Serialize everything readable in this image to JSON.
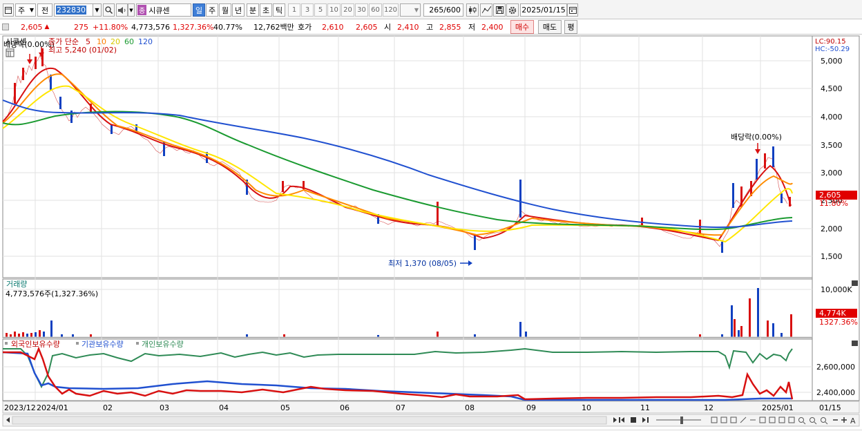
{
  "toolbar": {
    "market": "주",
    "prev": "전",
    "code": "232830",
    "stock_badge": "종",
    "stock_name": "시큐센",
    "periods": [
      "일",
      "주",
      "월",
      "년",
      "분",
      "초",
      "틱"
    ],
    "active_period": "일",
    "intervals": [
      "1",
      "3",
      "5",
      "10",
      "20",
      "30",
      "60",
      "120"
    ],
    "count": "265",
    "count_total": "/600",
    "date": "2025/01/15"
  },
  "quote": {
    "price": "2,605",
    "change": "275",
    "change_pct": "+11.80%",
    "volume": "4,773,576",
    "volume_pct": "1,327.36%",
    "turnover_pct": "40.77%",
    "amount": "12,762백만",
    "hoga_label": "호가",
    "ask": "2,610",
    "bid": "2,605",
    "open_label": "시",
    "open": "2,410",
    "high_label": "고",
    "high": "2,855",
    "low_label": "저",
    "low": "2,400",
    "buy": "매수",
    "sell": "매도",
    "eval": "평"
  },
  "price_panel": {
    "legend_name": "시큐센",
    "legend_items": [
      "종가 단순",
      "5",
      "10",
      "20",
      "60",
      "120"
    ],
    "legend_colors": [
      "#c00000",
      "#c00000",
      "#ff8000",
      "#e8e800",
      "#1a9a30",
      "#2050d0"
    ],
    "ex_div_top_left": "배당락(0.00%)",
    "high_marker": "최고 5,240 (01/02)",
    "ex_div_right": "배당락(0.00%)",
    "low_marker": "최저 1,370 (08/05)",
    "lc": "LC:90.15",
    "hc": "HC:-50.29",
    "last_price_tag": "2,605",
    "last_pct_tag": "11.80%",
    "y_ticks": [
      "5,000",
      "4,500",
      "4,000",
      "3,500",
      "3,000",
      "2,500",
      "2,000",
      "1,500"
    ]
  },
  "volume_panel": {
    "title": "거래량",
    "value": "4,773,576주(1,327.36%)",
    "y_tick": "10,000K",
    "tag_value": "4,774K",
    "tag_pct": "1327.36%"
  },
  "holding_panel": {
    "legend_foreign": "외국인보유수량",
    "legend_inst": "기관보유수량",
    "legend_indiv": "개인보유수량",
    "y_ticks": [
      "2,600,000",
      "2,400,000"
    ]
  },
  "x_axis": {
    "labels": [
      "2023/12",
      "2024/01",
      "02",
      "03",
      "04",
      "05",
      "06",
      "07",
      "08",
      "09",
      "10",
      "11",
      "12",
      "2025/01",
      "01/15"
    ]
  },
  "chart_data": {
    "type": "line",
    "series_price_approx": [
      3.9,
      4.6,
      5.0,
      4.1,
      4.1,
      3.7,
      3.4,
      3.0,
      2.45,
      2.65,
      2.45,
      2.1,
      2.0,
      1.9,
      2.3,
      2.1,
      2.0,
      2.05,
      1.85,
      2.0,
      3.0,
      2.6
    ],
    "x": [
      "2023/12",
      "2024/01",
      "02",
      "03",
      "04",
      "05",
      "06",
      "07",
      "08",
      "09",
      "10",
      "11",
      "12",
      "2025/01"
    ]
  }
}
